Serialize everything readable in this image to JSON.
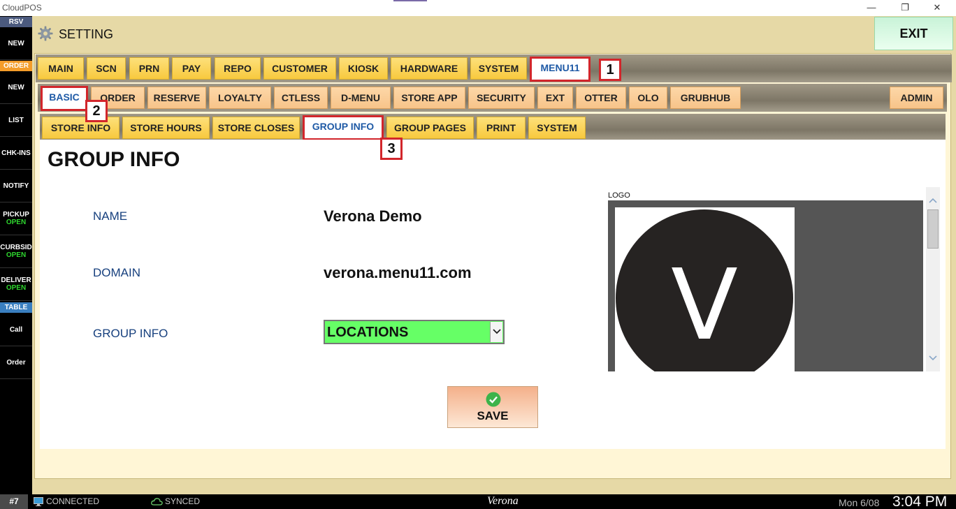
{
  "window": {
    "title": "CloudPOS",
    "minimize": "—",
    "restore": "❐",
    "close": "✕"
  },
  "sidebar": {
    "sections": {
      "rsv": {
        "label": "RSV",
        "color": "#4b5a7e"
      },
      "order": {
        "label": "ORDER",
        "color": "#f39c2a"
      },
      "table": {
        "label": "TABLE",
        "color": "#3a7fc0"
      }
    },
    "items": [
      {
        "label": "NEW",
        "sub": ""
      },
      {
        "label": "NEW",
        "sub": ""
      },
      {
        "label": "LIST",
        "sub": ""
      },
      {
        "label": "CHK-INS",
        "sub": ""
      },
      {
        "label": "NOTIFY",
        "sub": ""
      },
      {
        "label": "PICKUP",
        "sub": "OPEN"
      },
      {
        "label": "CURBSID",
        "sub": "OPEN"
      },
      {
        "label": "DELIVER",
        "sub": "OPEN"
      },
      {
        "label": "Call",
        "sub": ""
      },
      {
        "label": "Order",
        "sub": ""
      }
    ]
  },
  "header": {
    "title": "SETTING",
    "exit_label": "EXIT"
  },
  "tabs": {
    "main": [
      "MAIN",
      "SCN",
      "PRN",
      "PAY",
      "REPO",
      "CUSTOMER",
      "KIOSK",
      "HARDWARE",
      "SYSTEM",
      "MENU11"
    ],
    "sub": [
      "BASIC",
      "ORDER",
      "RESERVE",
      "LOYALTY",
      "CTLESS",
      "D-MENU",
      "STORE APP",
      "SECURITY",
      "EXT",
      "OTTER",
      "OLO",
      "GRUBHUB"
    ],
    "admin": "ADMIN",
    "third": [
      "STORE INFO",
      "STORE HOURS",
      "STORE CLOSES",
      "GROUP INFO",
      "GROUP PAGES",
      "PRINT",
      "SYSTEM"
    ]
  },
  "callouts": [
    "1",
    "2",
    "3"
  ],
  "content": {
    "title": "GROUP INFO",
    "fields": {
      "name_label": "NAME",
      "name_value": "Verona Demo",
      "domain_label": "DOMAIN",
      "domain_value": "verona.menu11.com",
      "group_label": "GROUP INFO",
      "group_value": "LOCATIONS"
    },
    "logo_label": "LOGO",
    "logo_letter": "V",
    "save_label": "SAVE"
  },
  "status": {
    "station": "#7",
    "connected": "CONNECTED",
    "synced": "SYNCED",
    "store": "Verona",
    "date": "Mon 6/08",
    "time": "3:04 PM"
  }
}
